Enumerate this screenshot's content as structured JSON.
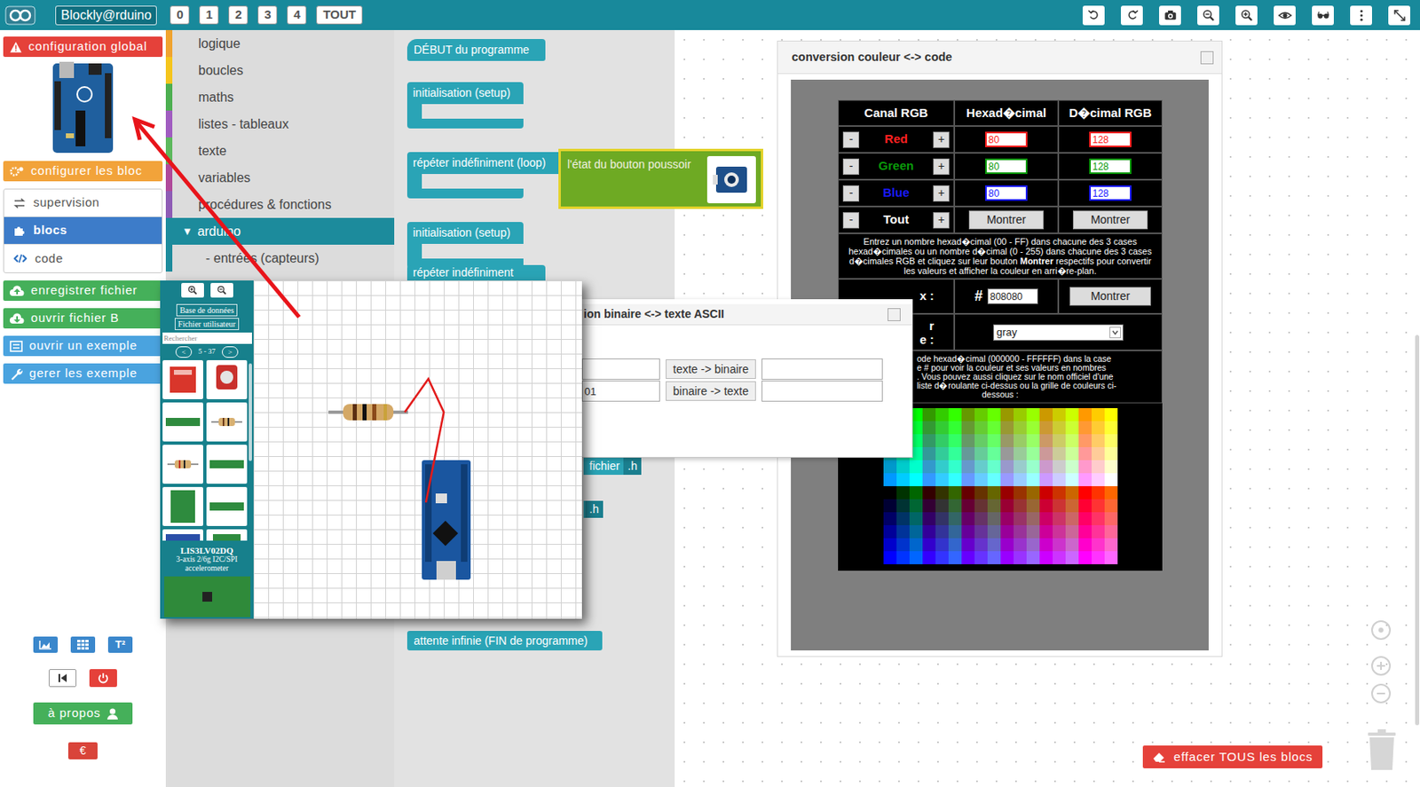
{
  "toolbar": {
    "logo": "Blockly@rduino",
    "tabs": [
      {
        "label": "0",
        "selected": false
      },
      {
        "label": "1",
        "selected": false
      },
      {
        "label": "2",
        "selected": false
      },
      {
        "label": "3",
        "selected": false
      },
      {
        "label": "4",
        "selected": false
      },
      {
        "label": "TOUT",
        "selected": false
      }
    ]
  },
  "sidebar": {
    "config": "configuration global",
    "blocks_config": "configurer les bloc",
    "views": [
      {
        "label": "supervision",
        "selected": false
      },
      {
        "label": "blocs",
        "selected": true
      },
      {
        "label": "code",
        "selected": false
      }
    ],
    "file_buttons": [
      {
        "label": "enregistrer fichier",
        "kind": "save",
        "color": "#45b05a"
      },
      {
        "label": "ouvrir fichier B",
        "kind": "open",
        "color": "#45b05a"
      },
      {
        "label": "ouvrir un exemple",
        "kind": "example",
        "color": "#4aa3df"
      },
      {
        "label": "gerer les exemple",
        "kind": "manage",
        "color": "#4aa3df"
      }
    ],
    "tool_badge": "T²",
    "about": "à propos",
    "donate": "€"
  },
  "toolbox": {
    "categories": [
      {
        "label": "logique",
        "toggle": "",
        "kind": "category",
        "selected": false,
        "color": "#f0a32e"
      },
      {
        "label": "boucles",
        "toggle": "",
        "kind": "category",
        "selected": false,
        "color": "#f5c51c"
      },
      {
        "label": "maths",
        "toggle": "",
        "kind": "category",
        "selected": false,
        "color": "#4caf50"
      },
      {
        "label": "listes - tableaux",
        "toggle": "",
        "kind": "category",
        "selected": false,
        "color": "#a05cc0"
      },
      {
        "label": "texte",
        "toggle": "",
        "kind": "category",
        "selected": false,
        "color": "#5cb85c"
      },
      {
        "label": "variables",
        "toggle": "",
        "kind": "category",
        "selected": false,
        "color": "#b0489a"
      },
      {
        "label": "procédures & fonctions",
        "toggle": "",
        "kind": "category",
        "selected": false,
        "color": "#8e5bb5"
      },
      {
        "label": "arduino",
        "toggle": "▼",
        "kind": "category",
        "selected": true,
        "color": "#1c8b9c"
      },
      {
        "label": "- entrées (capteurs)",
        "toggle": "",
        "kind": "subcategory",
        "selected": false,
        "color": "#1c8b9c"
      }
    ]
  },
  "flyout": {
    "blocks": [
      {
        "label": "DÉBUT du programme",
        "kind": "hat"
      },
      {
        "label": "initialisation (setup)",
        "kind": "c"
      },
      {
        "label": "répéter indéfiniment (loop)",
        "kind": "c"
      },
      {
        "label": "initialisation (setup)",
        "kind": "c"
      },
      {
        "label": "répéter indéfiniment (loop)",
        "kind": "cut"
      },
      {
        "label": "attente infinie (FIN de programme)",
        "kind": "plain"
      }
    ],
    "header_blocks": [
      {
        "parts": [
          "fichier",
          ".h"
        ]
      },
      {
        "parts": [
          ".h"
        ]
      }
    ]
  },
  "drag_block": {
    "label": "l'état du bouton poussoir"
  },
  "parts_window": {
    "buttons": [
      "Base de données",
      "Fichier utilisateur"
    ],
    "search_placeholder": "Rechercher",
    "pager": {
      "prev": "<",
      "range": "5 - 37",
      "next": ">"
    },
    "part": {
      "name": "LIS3LV02DQ",
      "lines": [
        "3-axis 2/6g I2C/SPI",
        "accelerometer"
      ]
    }
  },
  "binary_window": {
    "title": "ion binaire <-> texte ASCII",
    "rows": [
      {
        "input": "",
        "button": "texte -> binaire",
        "output": ""
      },
      {
        "input": "01",
        "button": "binaire -> texte",
        "output": ""
      }
    ]
  },
  "color_window": {
    "title": "conversion couleur <-> code",
    "headers": [
      "Canal RGB",
      "Hexad�cimal",
      "D�cimal RGB"
    ],
    "minus": "-",
    "plus": "+",
    "channels": [
      {
        "name": "Red",
        "hex": "80",
        "dec": "128",
        "color": "#ff2020"
      },
      {
        "name": "Green",
        "hex": "80",
        "dec": "128",
        "color": "#0a9a0a"
      },
      {
        "name": "Blue",
        "hex": "80",
        "dec": "128",
        "color": "#1a1aff"
      }
    ],
    "all": {
      "name": "Tout",
      "buttons": [
        "Montrer",
        "Montrer"
      ]
    },
    "help1": {
      "before": "Entrez un nombre hexad�cimal (00 - FF) dans chacune des 3 cases hexad�cimales ou un nombre d�cimal (0 - 255) dans chacune des 3 cases d�cimales RGB et cliquez sur leur bouton ",
      "bold": "Montrer",
      "after": " respectifs pour convertir les valeurs et afficher la couleur en arri�re-plan."
    },
    "hex_row": {
      "label": "x :",
      "hash": "#",
      "value": "808080",
      "button": "Montrer"
    },
    "name_row": {
      "label_top": "r",
      "label_bottom": "e :",
      "value": "gray"
    },
    "help2": [
      "ode hexad�cimal (000000 - FFFFFF) dans la case",
      "e # pour voir la couleur et ses valeurs en nombres",
      ". Vous pouvez aussi cliquez sur le nom officiel d'une",
      "liste d�roulante ci-dessus ou la grille de couleurs ci-",
      "dessous :"
    ],
    "color_grid": [
      [
        "#009900",
        "#00CC00",
        "#00FF00",
        "#339900",
        "#33CC00",
        "#33FF00",
        "#669900",
        "#66CC00",
        "#66FF00",
        "#999900",
        "#99CC00",
        "#99FF00",
        "#CC9900",
        "#CCCC00",
        "#CCFF00",
        "#FF9900",
        "#FFCC00",
        "#FFFF00"
      ],
      [
        "#009933",
        "#00CC33",
        "#00FF33",
        "#339933",
        "#33CC33",
        "#33FF33",
        "#669933",
        "#66CC33",
        "#66FF33",
        "#999933",
        "#99CC33",
        "#99FF33",
        "#CC9933",
        "#CCCC33",
        "#CCFF33",
        "#FF9933",
        "#FFCC33",
        "#FFFF33"
      ],
      [
        "#009966",
        "#00CC66",
        "#00FF66",
        "#339966",
        "#33CC66",
        "#33FF66",
        "#669966",
        "#66CC66",
        "#66FF66",
        "#999966",
        "#99CC66",
        "#99FF66",
        "#CC9966",
        "#CCCC66",
        "#CCFF66",
        "#FF9966",
        "#FFCC66",
        "#FFFF66"
      ],
      [
        "#009999",
        "#00CC99",
        "#00FF99",
        "#339999",
        "#33CC99",
        "#33FF99",
        "#669999",
        "#66CC99",
        "#66FF99",
        "#999999",
        "#99CC99",
        "#99FF99",
        "#CC9999",
        "#CCCC99",
        "#CCFF99",
        "#FF9999",
        "#FFCC99",
        "#FFFF99"
      ],
      [
        "#0099CC",
        "#00CCCC",
        "#00FFCC",
        "#3399CC",
        "#33CCCC",
        "#33FFCC",
        "#6699CC",
        "#66CCCC",
        "#66FFCC",
        "#9999CC",
        "#99CCCC",
        "#99FFCC",
        "#CC99CC",
        "#CCCCCC",
        "#CCFFCC",
        "#FF99CC",
        "#FFCCCC",
        "#FFFFCC"
      ],
      [
        "#0099FF",
        "#00CCFF",
        "#00FFFF",
        "#3399FF",
        "#33CCFF",
        "#33FFFF",
        "#6699FF",
        "#66CCFF",
        "#66FFFF",
        "#9999FF",
        "#99CCFF",
        "#99FFFF",
        "#CC99FF",
        "#CCCCFF",
        "#CCFFFF",
        "#FF99FF",
        "#FFCCFF",
        "#FFFFFF"
      ],
      [
        "#000000",
        "#003300",
        "#006600",
        "#330000",
        "#333300",
        "#336600",
        "#660000",
        "#663300",
        "#666600",
        "#990000",
        "#993300",
        "#996600",
        "#CC0000",
        "#CC3300",
        "#CC6600",
        "#FF0000",
        "#FF3300",
        "#FF6600"
      ],
      [
        "#000033",
        "#003333",
        "#006633",
        "#330033",
        "#333333",
        "#336633",
        "#660033",
        "#663333",
        "#666633",
        "#990033",
        "#993333",
        "#996633",
        "#CC0033",
        "#CC3333",
        "#CC6633",
        "#FF0033",
        "#FF3333",
        "#FF6633"
      ],
      [
        "#000066",
        "#003366",
        "#006666",
        "#330066",
        "#333366",
        "#336666",
        "#660066",
        "#663366",
        "#666666",
        "#990066",
        "#993366",
        "#996666",
        "#CC0066",
        "#CC3366",
        "#CC6666",
        "#FF0066",
        "#FF3366",
        "#FF6666"
      ],
      [
        "#000099",
        "#003399",
        "#006699",
        "#330099",
        "#333399",
        "#336699",
        "#660099",
        "#663399",
        "#666699",
        "#990099",
        "#993399",
        "#996699",
        "#CC0099",
        "#CC3399",
        "#CC6699",
        "#FF0099",
        "#FF3399",
        "#FF6699"
      ],
      [
        "#0000CC",
        "#0033CC",
        "#0066CC",
        "#3300CC",
        "#3333CC",
        "#3366CC",
        "#6600CC",
        "#6633CC",
        "#6666CC",
        "#9900CC",
        "#9933CC",
        "#9966CC",
        "#CC00CC",
        "#CC33CC",
        "#CC66CC",
        "#FF00CC",
        "#FF33CC",
        "#FF66CC"
      ],
      [
        "#0000FF",
        "#0033FF",
        "#0066FF",
        "#3300FF",
        "#3333FF",
        "#3366FF",
        "#6600FF",
        "#6633FF",
        "#6666FF",
        "#9900FF",
        "#9933FF",
        "#9966FF",
        "#CC00FF",
        "#CC33FF",
        "#CC66FF",
        "#FF00FF",
        "#FF33FF",
        "#FF66FF"
      ]
    ]
  },
  "workspace": {
    "clear_button": "effacer TOUS les blocs"
  }
}
